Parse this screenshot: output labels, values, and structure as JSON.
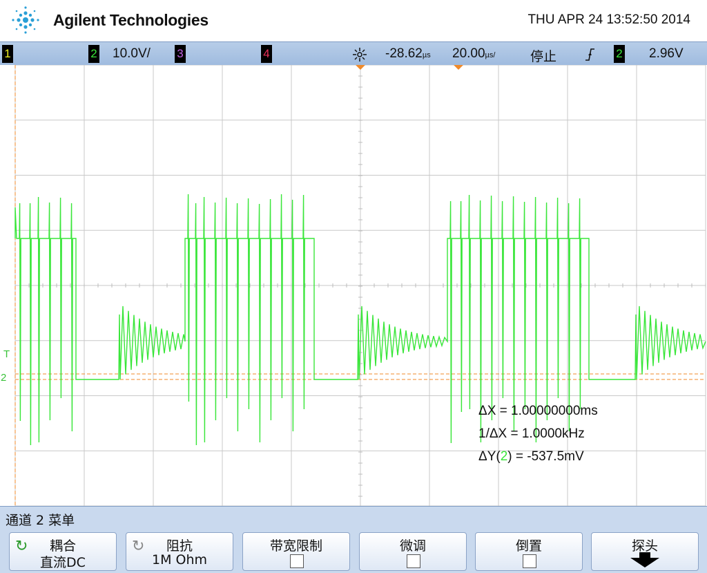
{
  "header": {
    "brand": "Agilent Technologies",
    "datetime": "THU APR 24 13:52:50 2014"
  },
  "statusbar": {
    "ch1_label": "1",
    "ch2_label": "2",
    "ch2_scale": "10.0V/",
    "ch3_label": "3",
    "ch4_label": "4",
    "time_offset": "-28.62",
    "time_offset_unit": "µs",
    "time_scale": "20.00",
    "time_scale_unit": "µs/",
    "run_state": "停止",
    "trigger_source": "2",
    "trigger_level": "2.96V"
  },
  "colors": {
    "ch1": "#f0f020",
    "ch2": "#39e639",
    "ch3": "#c060e0",
    "ch4": "#e8305a",
    "cursor": "#f08a2a",
    "grid": "#c8c8c8"
  },
  "markers": {
    "trigger": "T",
    "ch2": "2"
  },
  "measurements": {
    "dx": "ΔX = 1.00000000ms",
    "inv_dx": "1/ΔX = 1.0000kHz",
    "dy_prefix": "ΔY(",
    "dy_channel": "2",
    "dy_suffix": ") = -537.5mV"
  },
  "menu": {
    "title": "通道 2 菜单"
  },
  "softkeys": [
    {
      "line1": "耦合",
      "line2": "直流DC",
      "icon": "rotate-icon"
    },
    {
      "line1": "阻抗",
      "line2": "1M Ohm",
      "icon": "rotate-icon"
    },
    {
      "line1": "带宽限制",
      "checked": false
    },
    {
      "line1": "微调",
      "checked": false
    },
    {
      "line1": "倒置",
      "checked": false
    },
    {
      "line1": "探头",
      "icon": "down-arrow-icon"
    }
  ]
}
